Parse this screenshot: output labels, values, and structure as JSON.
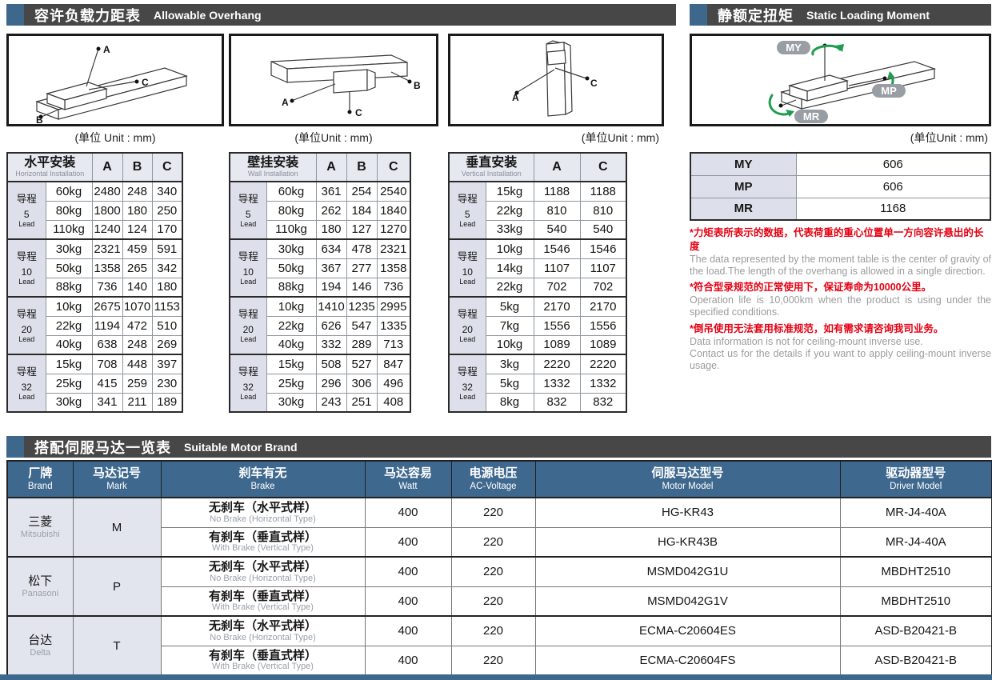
{
  "sections": {
    "overhang": {
      "title_zh": "容许负载力距表",
      "title_en": "Allowable Overhang"
    },
    "moment": {
      "title_zh": "静额定扭矩",
      "title_en": "Static Loading Moment"
    },
    "motor": {
      "title_zh": "搭配伺服马达一览表",
      "title_en": "Suitable Motor Brand"
    }
  },
  "diagrams": [
    {
      "caption": "(单位 Unit : mm)",
      "labels": [
        "A",
        "B",
        "C"
      ]
    },
    {
      "caption": "(单位Unit : mm)",
      "labels": [
        "A",
        "B",
        "C"
      ]
    },
    {
      "caption": "(单位Unit : mm)",
      "labels": [
        "A",
        "C"
      ]
    },
    {
      "caption": "(单位Unit : mm)",
      "labels": [
        "MY",
        "MP",
        "MR"
      ]
    }
  ],
  "overhang_tables": [
    {
      "name_zh": "水平安装",
      "name_en": "Horizontal Installation",
      "columns": [
        "A",
        "B",
        "C"
      ],
      "groups": [
        {
          "lead_label": "导程",
          "lead_value": "5",
          "lead_en": "Lead",
          "rows": [
            {
              "load": "60kg",
              "values": [
                "2480",
                "248",
                "340"
              ]
            },
            {
              "load": "80kg",
              "values": [
                "1800",
                "180",
                "250"
              ]
            },
            {
              "load": "110kg",
              "values": [
                "1240",
                "124",
                "170"
              ]
            }
          ]
        },
        {
          "lead_label": "导程",
          "lead_value": "10",
          "lead_en": "Lead",
          "rows": [
            {
              "load": "30kg",
              "values": [
                "2321",
                "459",
                "591"
              ]
            },
            {
              "load": "50kg",
              "values": [
                "1358",
                "265",
                "342"
              ]
            },
            {
              "load": "88kg",
              "values": [
                "736",
                "140",
                "180"
              ]
            }
          ]
        },
        {
          "lead_label": "导程",
          "lead_value": "20",
          "lead_en": "Lead",
          "rows": [
            {
              "load": "10kg",
              "values": [
                "2675",
                "1070",
                "1153"
              ]
            },
            {
              "load": "22kg",
              "values": [
                "1194",
                "472",
                "510"
              ]
            },
            {
              "load": "40kg",
              "values": [
                "638",
                "248",
                "269"
              ]
            }
          ]
        },
        {
          "lead_label": "导程",
          "lead_value": "32",
          "lead_en": "Lead",
          "rows": [
            {
              "load": "15kg",
              "values": [
                "708",
                "448",
                "397"
              ]
            },
            {
              "load": "25kg",
              "values": [
                "415",
                "259",
                "230"
              ]
            },
            {
              "load": "30kg",
              "values": [
                "341",
                "211",
                "189"
              ]
            }
          ]
        }
      ]
    },
    {
      "name_zh": "壁挂安装",
      "name_en": "Wall Installation",
      "columns": [
        "A",
        "B",
        "C"
      ],
      "groups": [
        {
          "lead_label": "导程",
          "lead_value": "5",
          "lead_en": "Lead",
          "rows": [
            {
              "load": "60kg",
              "values": [
                "361",
                "254",
                "2540"
              ]
            },
            {
              "load": "80kg",
              "values": [
                "262",
                "184",
                "1840"
              ]
            },
            {
              "load": "110kg",
              "values": [
                "180",
                "127",
                "1270"
              ]
            }
          ]
        },
        {
          "lead_label": "导程",
          "lead_value": "10",
          "lead_en": "Lead",
          "rows": [
            {
              "load": "30kg",
              "values": [
                "634",
                "478",
                "2321"
              ]
            },
            {
              "load": "50kg",
              "values": [
                "367",
                "277",
                "1358"
              ]
            },
            {
              "load": "88kg",
              "values": [
                "194",
                "146",
                "736"
              ]
            }
          ]
        },
        {
          "lead_label": "导程",
          "lead_value": "20",
          "lead_en": "Lead",
          "rows": [
            {
              "load": "10kg",
              "values": [
                "1410",
                "1235",
                "2995"
              ]
            },
            {
              "load": "22kg",
              "values": [
                "626",
                "547",
                "1335"
              ]
            },
            {
              "load": "40kg",
              "values": [
                "332",
                "289",
                "713"
              ]
            }
          ]
        },
        {
          "lead_label": "导程",
          "lead_value": "32",
          "lead_en": "Lead",
          "rows": [
            {
              "load": "15kg",
              "values": [
                "508",
                "527",
                "847"
              ]
            },
            {
              "load": "25kg",
              "values": [
                "296",
                "306",
                "496"
              ]
            },
            {
              "load": "30kg",
              "values": [
                "243",
                "251",
                "408"
              ]
            }
          ]
        }
      ]
    },
    {
      "name_zh": "垂直安装",
      "name_en": "Vertical Installation",
      "columns": [
        "A",
        "C"
      ],
      "groups": [
        {
          "lead_label": "导程",
          "lead_value": "5",
          "lead_en": "Lead",
          "rows": [
            {
              "load": "15kg",
              "values": [
                "1188",
                "1188"
              ]
            },
            {
              "load": "22kg",
              "values": [
                "810",
                "810"
              ]
            },
            {
              "load": "33kg",
              "values": [
                "540",
                "540"
              ]
            }
          ]
        },
        {
          "lead_label": "导程",
          "lead_value": "10",
          "lead_en": "Lead",
          "rows": [
            {
              "load": "10kg",
              "values": [
                "1546",
                "1546"
              ]
            },
            {
              "load": "14kg",
              "values": [
                "1107",
                "1107"
              ]
            },
            {
              "load": "22kg",
              "values": [
                "702",
                "702"
              ]
            }
          ]
        },
        {
          "lead_label": "导程",
          "lead_value": "20",
          "lead_en": "Lead",
          "rows": [
            {
              "load": "5kg",
              "values": [
                "2170",
                "2170"
              ]
            },
            {
              "load": "7kg",
              "values": [
                "1556",
                "1556"
              ]
            },
            {
              "load": "10kg",
              "values": [
                "1089",
                "1089"
              ]
            }
          ]
        },
        {
          "lead_label": "导程",
          "lead_value": "32",
          "lead_en": "Lead",
          "rows": [
            {
              "load": "3kg",
              "values": [
                "2220",
                "2220"
              ]
            },
            {
              "load": "5kg",
              "values": [
                "1332",
                "1332"
              ]
            },
            {
              "load": "8kg",
              "values": [
                "832",
                "832"
              ]
            }
          ]
        }
      ]
    }
  ],
  "moment_table": {
    "rows": [
      {
        "label": "MY",
        "value": "606"
      },
      {
        "label": "MP",
        "value": "606"
      },
      {
        "label": "MR",
        "value": "1168"
      }
    ]
  },
  "notes": [
    {
      "zh": "*力矩表所表示的数据，代表荷重的重心位置单一方向容许悬出的长度",
      "en_lines": [
        "The data represented by the moment table is the center of gravity of the load.The length of the overhang is allowed in a single direction."
      ]
    },
    {
      "zh": "*符合型录规范的正常使用下，保证寿命为10000公里。",
      "en_lines": [
        "Operation life is 10,000km when the product is using under the specified conditions."
      ]
    },
    {
      "zh": "*倒吊使用无法套用标准规范，如有需求请咨询我司业务。",
      "en_lines": [
        "Data information is not for ceiling-mount inverse use.",
        "Contact us for the details if you want to apply ceiling-mount inverse usage."
      ]
    }
  ],
  "motor_table": {
    "headers": [
      {
        "zh": "厂牌",
        "en": "Brand"
      },
      {
        "zh": "马达记号",
        "en": "Mark"
      },
      {
        "zh": "刹车有无",
        "en": "Brake"
      },
      {
        "zh": "马达容易",
        "en": "Watt"
      },
      {
        "zh": "电源电压",
        "en": "AC-Voltage"
      },
      {
        "zh": "伺服马达型号",
        "en": "Motor Model"
      },
      {
        "zh": "驱动器型号",
        "en": "Driver Model"
      }
    ],
    "brands": [
      {
        "zh": "三菱",
        "en": "Mitsubishi",
        "mark": "M",
        "rows": [
          {
            "brake_zh": "无刹车（水平式样）",
            "brake_en": "No Brake (Horizontal Type)",
            "watt": "400",
            "voltage": "220",
            "motor": "HG-KR43",
            "driver": "MR-J4-40A"
          },
          {
            "brake_zh": "有刹车（垂直式样）",
            "brake_en": "With Brake (Vertical Type)",
            "watt": "400",
            "voltage": "220",
            "motor": "HG-KR43B",
            "driver": "MR-J4-40A"
          }
        ]
      },
      {
        "zh": "松下",
        "en": "Panasoni",
        "mark": "P",
        "rows": [
          {
            "brake_zh": "无刹车（水平式样）",
            "brake_en": "No Brake (Horizontal Type)",
            "watt": "400",
            "voltage": "220",
            "motor": "MSMD042G1U",
            "driver": "MBDHT2510"
          },
          {
            "brake_zh": "有刹车（垂直式样）",
            "brake_en": "With Brake (Vertical Type)",
            "watt": "400",
            "voltage": "220",
            "motor": "MSMD042G1V",
            "driver": "MBDHT2510"
          }
        ]
      },
      {
        "zh": "台达",
        "en": "Delta",
        "mark": "T",
        "rows": [
          {
            "brake_zh": "无刹车（水平式样）",
            "brake_en": "No Brake (Horizontal Type)",
            "watt": "400",
            "voltage": "220",
            "motor": "ECMA-C20604ES",
            "driver": "ASD-B20421-B"
          },
          {
            "brake_zh": "有刹车（垂直式样）",
            "brake_en": "With Brake (Vertical Type)",
            "watt": "400",
            "voltage": "220",
            "motor": "ECMA-C20604FS",
            "driver": "ASD-B20421-B"
          }
        ]
      }
    ]
  }
}
